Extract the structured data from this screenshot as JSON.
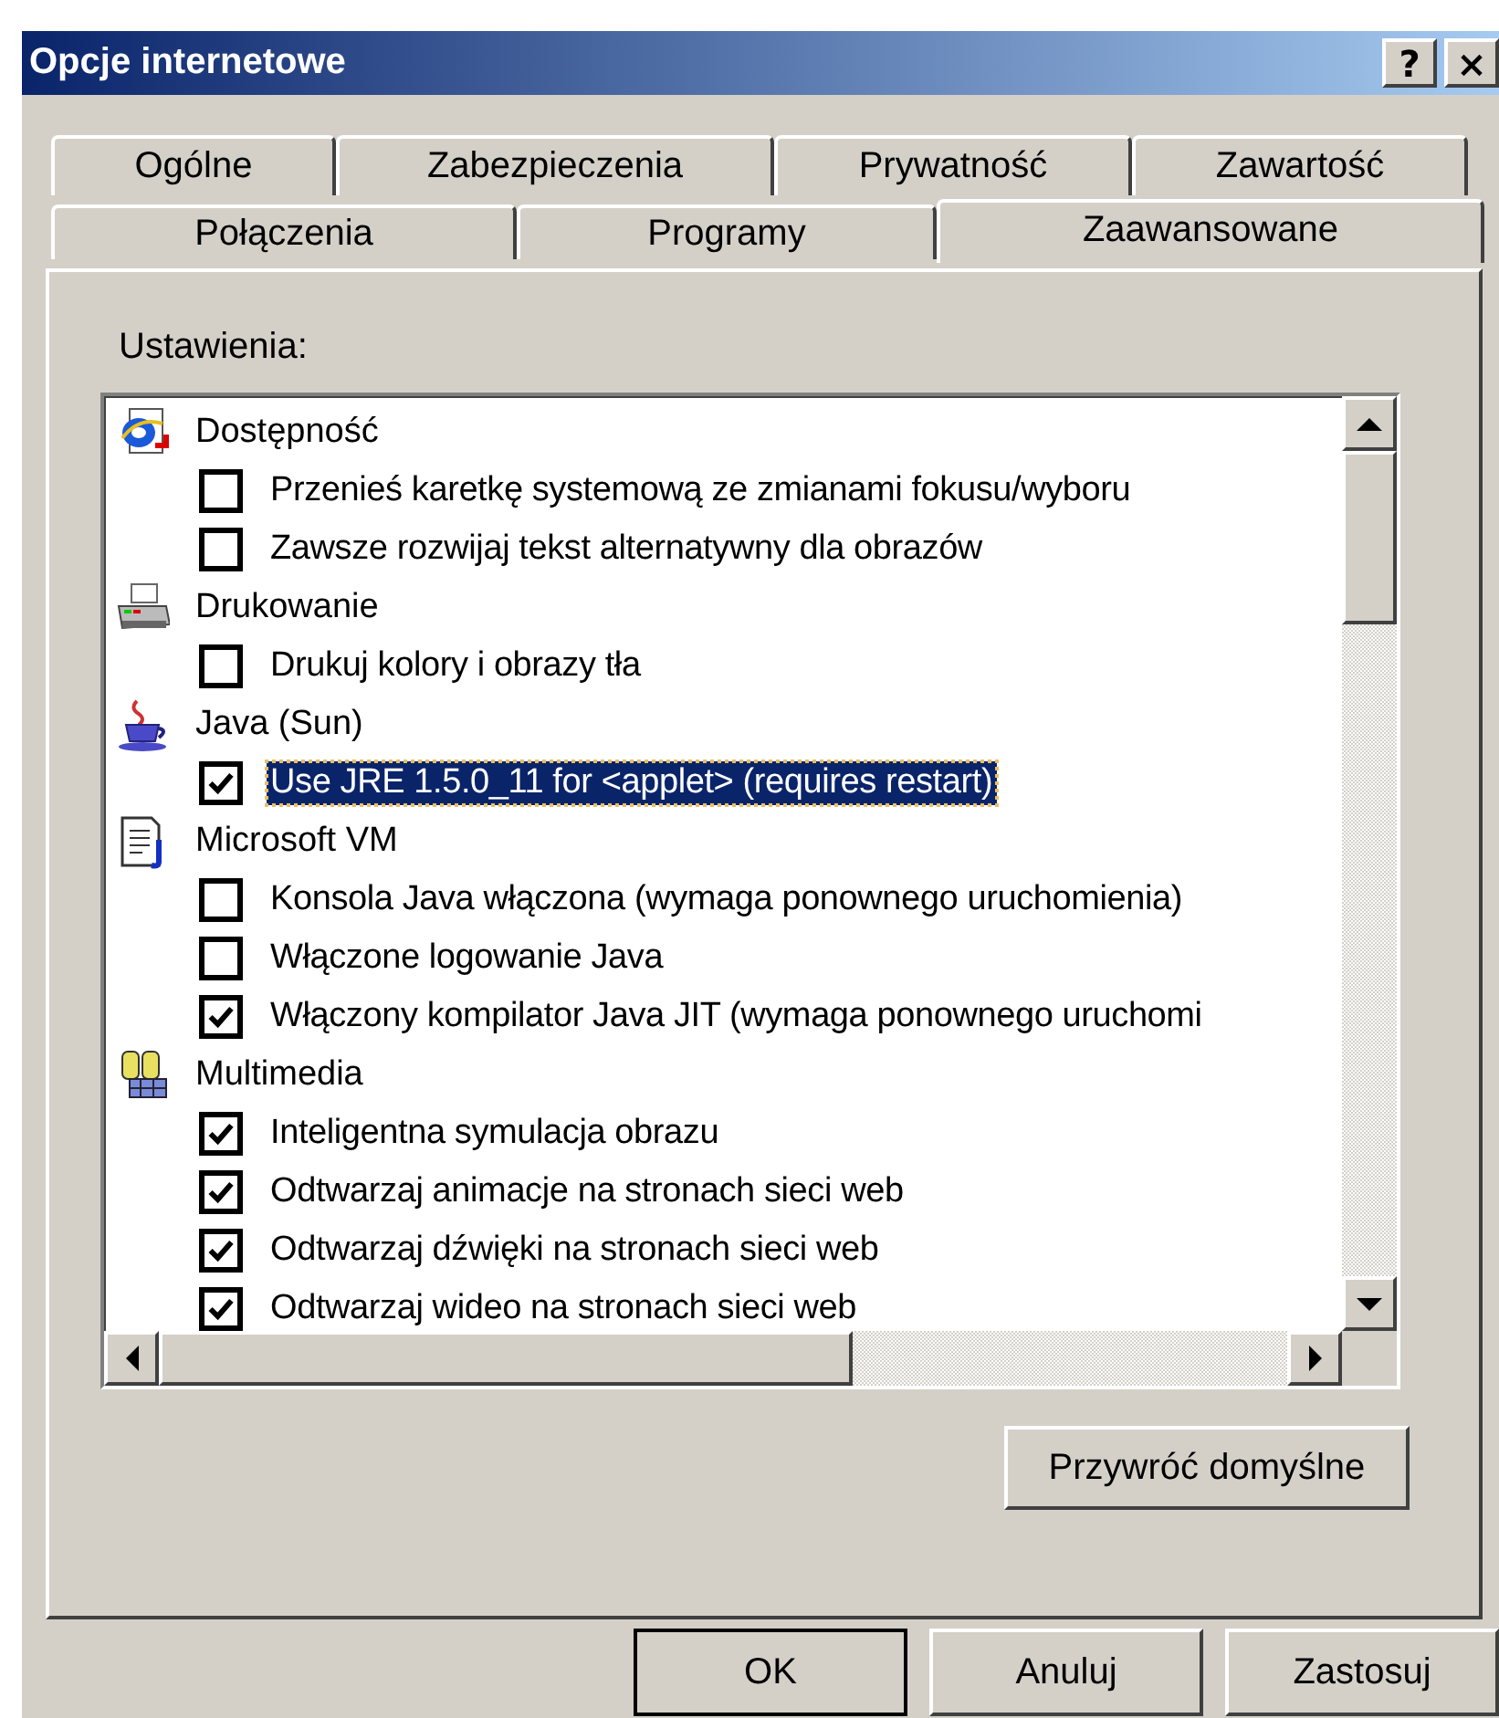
{
  "window": {
    "title": "Opcje internetowe",
    "title_buttons": [
      "?",
      "×"
    ]
  },
  "tab_rows": [
    [
      {
        "label": "Ogólne",
        "selected": false
      },
      {
        "label": "Zabezpieczenia",
        "selected": false
      },
      {
        "label": "Prywatność",
        "selected": false
      },
      {
        "label": "Zawartość",
        "selected": false
      }
    ],
    [
      {
        "label": "Połączenia",
        "selected": false
      },
      {
        "label": "Programy",
        "selected": false
      },
      {
        "label": "Zaawansowane",
        "selected": true
      }
    ]
  ],
  "settings": {
    "label": "Ustawienia:",
    "categories": [
      {
        "kind": "accessibility",
        "label": "Dostępność",
        "options": [
          {
            "label": "Przenieś karetkę systemową ze zmianami fokusu/wyboru",
            "checked": false,
            "selected": false
          },
          {
            "label": "Zawsze rozwijaj tekst alternatywny dla obrazów",
            "checked": false,
            "selected": false
          }
        ]
      },
      {
        "kind": "printing",
        "label": "Drukowanie",
        "options": [
          {
            "label": "Drukuj kolory i obrazy tła",
            "checked": false,
            "selected": false
          }
        ]
      },
      {
        "kind": "java",
        "label": "Java (Sun)",
        "options": [
          {
            "label": "Use JRE 1.5.0_11 for <applet> (requires restart)",
            "checked": true,
            "selected": true
          }
        ]
      },
      {
        "kind": "document",
        "label": "Microsoft VM",
        "options": [
          {
            "label": "Konsola Java włączona (wymaga ponownego uruchomienia)",
            "checked": false,
            "selected": false
          },
          {
            "label": "Włączone logowanie Java",
            "checked": false,
            "selected": false
          },
          {
            "label": "Włączony kompilator Java JIT (wymaga ponownego uruchomi",
            "checked": true,
            "selected": false
          }
        ]
      },
      {
        "kind": "multimedia",
        "label": "Multimedia",
        "options": [
          {
            "label": "Inteligentna symulacja obrazu",
            "checked": true,
            "selected": false
          },
          {
            "label": "Odtwarzaj animacje na stronach sieci web",
            "checked": true,
            "selected": false
          },
          {
            "label": "Odtwarzaj dźwięki na stronach sieci web",
            "checked": true,
            "selected": false
          },
          {
            "label": "Odtwarzaj wideo na stronach sieci web",
            "checked": true,
            "selected": false
          }
        ]
      }
    ]
  },
  "restore_button": "Przywróć domyślne",
  "buttons": [
    {
      "label": "OK",
      "default": true
    },
    {
      "label": "Anuluj",
      "default": false
    },
    {
      "label": "Zastosuj",
      "default": false
    }
  ]
}
